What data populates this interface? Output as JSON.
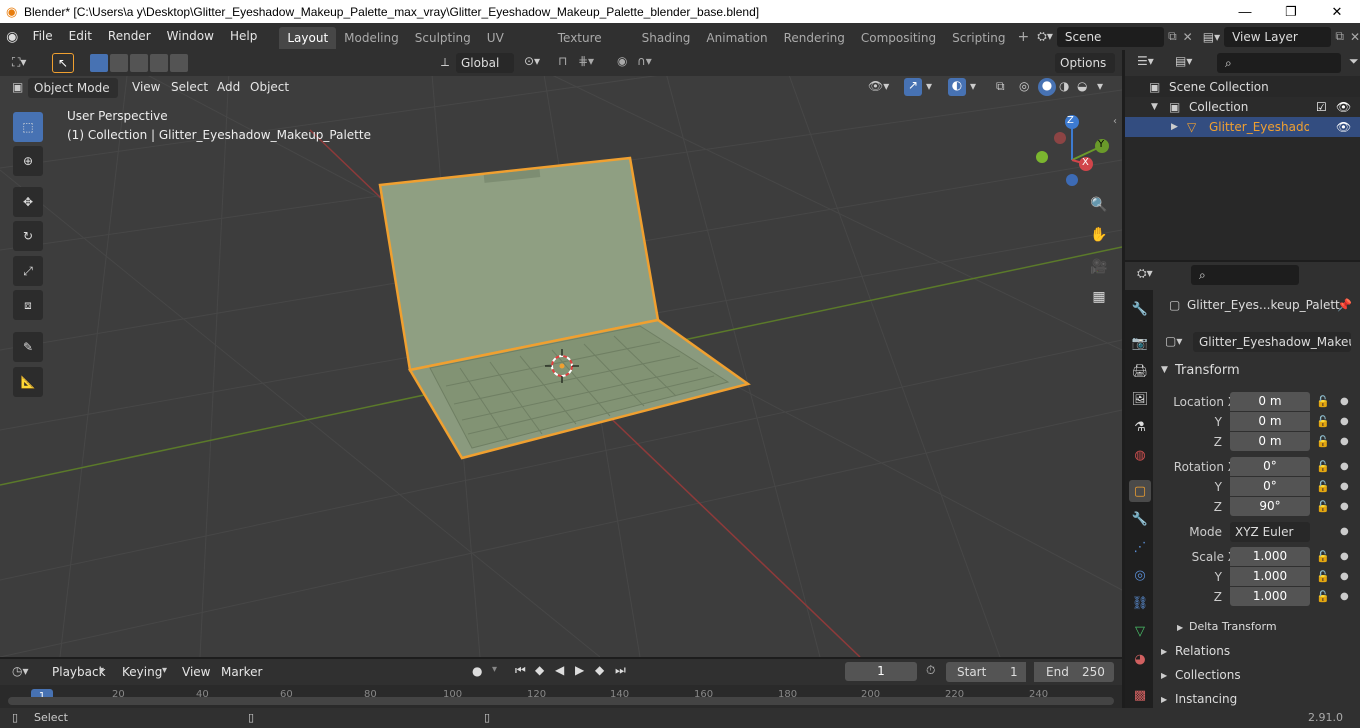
{
  "window": {
    "title": "Blender* [C:\\Users\\a y\\Desktop\\Glitter_Eyeshadow_Makeup_Palette_max_vray\\Glitter_Eyeshadow_Makeup_Palette_blender_base.blend]",
    "minimize": "—",
    "maximize": "❐",
    "close": "✕"
  },
  "menu": [
    "File",
    "Edit",
    "Render",
    "Window",
    "Help"
  ],
  "workspaces": [
    "Layout",
    "Modeling",
    "Sculpting",
    "UV Editing",
    "Texture Paint",
    "Shading",
    "Animation",
    "Rendering",
    "Compositing",
    "Scripting"
  ],
  "scene": "Scene",
  "view_layer": "View Layer",
  "header": {
    "transform": "Global",
    "options": "Options"
  },
  "viewport_header": {
    "mode": "Object Mode",
    "menus": [
      "View",
      "Select",
      "Add",
      "Object"
    ]
  },
  "overlay": {
    "perspective": "User Perspective",
    "collection": "(1) Collection | Glitter_Eyeshadow_Makeup_Palette"
  },
  "gizmo": {
    "x": "X",
    "y": "Y",
    "z": "Z"
  },
  "outliner": {
    "scene_collection": "Scene Collection",
    "collection": "Collection",
    "object": "Glitter_Eyeshadow_M"
  },
  "properties": {
    "object_name": "Glitter_Eyes...keup_Palett",
    "data_name": "Glitter_Eyeshadow_Makeup...",
    "transform": "Transform",
    "location": {
      "label": "Location X",
      "x": "0 m",
      "y": "0 m",
      "z": "0 m"
    },
    "rotation": {
      "label": "Rotation X",
      "x": "0°",
      "y": "0°",
      "z": "90°"
    },
    "mode_label": "Mode",
    "mode": "XYZ Euler",
    "scale": {
      "label": "Scale X",
      "x": "1.000",
      "y": "1.000",
      "z": "1.000"
    },
    "axis_y": "Y",
    "axis_z": "Z",
    "sections": [
      "Delta Transform",
      "Relations",
      "Collections",
      "Instancing"
    ]
  },
  "timeline": {
    "menus": [
      "Playback",
      "Keying",
      "View",
      "Marker"
    ],
    "frame": "1",
    "start_label": "Start",
    "start": "1",
    "end_label": "End",
    "end": "250",
    "ticks": [
      "1",
      "20",
      "40",
      "60",
      "80",
      "100",
      "120",
      "140",
      "160",
      "180",
      "200",
      "220",
      "240"
    ]
  },
  "status": {
    "select": "Select",
    "version": "2.91.0"
  }
}
